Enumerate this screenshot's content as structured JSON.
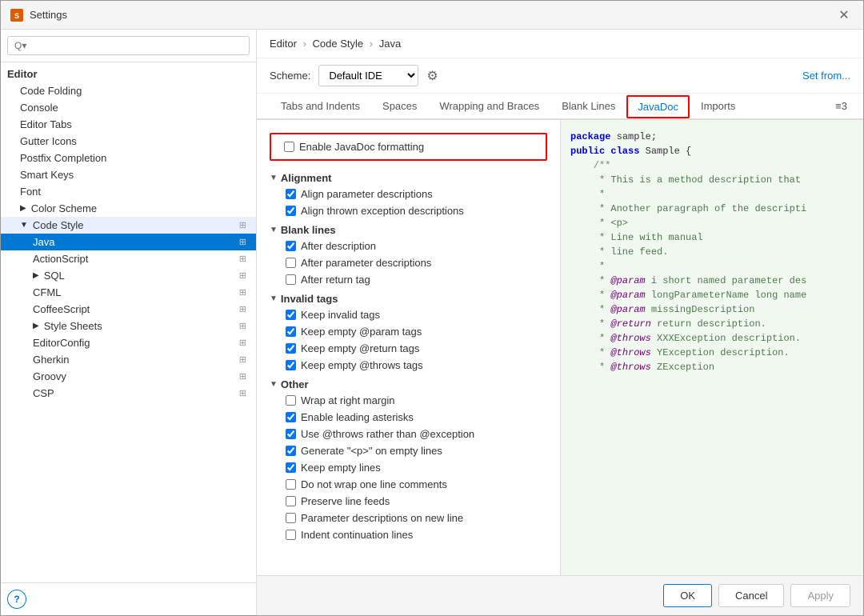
{
  "window": {
    "title": "Settings",
    "close_label": "✕"
  },
  "search": {
    "placeholder": "Q▾",
    "value": ""
  },
  "sidebar": {
    "sections": [
      {
        "id": "editor",
        "label": "Editor",
        "level": "parent",
        "expanded": true
      },
      {
        "id": "code-folding",
        "label": "Code Folding",
        "level": "level1"
      },
      {
        "id": "console",
        "label": "Console",
        "level": "level1"
      },
      {
        "id": "editor-tabs",
        "label": "Editor Tabs",
        "level": "level1"
      },
      {
        "id": "gutter-icons",
        "label": "Gutter Icons",
        "level": "level1"
      },
      {
        "id": "postfix-completion",
        "label": "Postfix Completion",
        "level": "level1"
      },
      {
        "id": "smart-keys",
        "label": "Smart Keys",
        "level": "level1"
      },
      {
        "id": "font",
        "label": "Font",
        "level": "level1"
      },
      {
        "id": "color-scheme",
        "label": "Color Scheme",
        "level": "level1",
        "expandable": true
      },
      {
        "id": "code-style",
        "label": "Code Style",
        "level": "level1",
        "expandable": true,
        "expanded": true,
        "selected_parent": true
      },
      {
        "id": "java",
        "label": "Java",
        "level": "level2",
        "selected": true
      },
      {
        "id": "actionscript",
        "label": "ActionScript",
        "level": "level2"
      },
      {
        "id": "sql",
        "label": "SQL",
        "level": "level2",
        "expandable": true
      },
      {
        "id": "cfml",
        "label": "CFML",
        "level": "level2"
      },
      {
        "id": "coffeescript",
        "label": "CoffeeScript",
        "level": "level2"
      },
      {
        "id": "style-sheets",
        "label": "Style Sheets",
        "level": "level2",
        "expandable": true
      },
      {
        "id": "editorconfig",
        "label": "EditorConfig",
        "level": "level2"
      },
      {
        "id": "gherkin",
        "label": "Gherkin",
        "level": "level2"
      },
      {
        "id": "groovy",
        "label": "Groovy",
        "level": "level2"
      },
      {
        "id": "csp",
        "label": "CSP",
        "level": "level2"
      }
    ]
  },
  "breadcrumb": {
    "items": [
      "Editor",
      "Code Style",
      "Java"
    ]
  },
  "scheme": {
    "label": "Scheme:",
    "value": "Default IDE",
    "bold_part": "Default",
    "normal_part": " IDE",
    "set_from_label": "Set from..."
  },
  "tabs": [
    {
      "id": "tabs-indents",
      "label": "Tabs and Indents"
    },
    {
      "id": "spaces",
      "label": "Spaces"
    },
    {
      "id": "wrapping",
      "label": "Wrapping and Braces"
    },
    {
      "id": "blank-lines",
      "label": "Blank Lines"
    },
    {
      "id": "javadoc",
      "label": "JavaDoc",
      "active": true,
      "highlighted": true
    },
    {
      "id": "imports",
      "label": "Imports"
    },
    {
      "id": "more",
      "label": "≡3"
    }
  ],
  "javadoc": {
    "enable_label": "Enable JavaDoc formatting",
    "enable_checked": false,
    "sections": [
      {
        "id": "alignment",
        "label": "Alignment",
        "expanded": true,
        "items": [
          {
            "id": "align-param",
            "label": "Align parameter descriptions",
            "checked": true
          },
          {
            "id": "align-throws",
            "label": "Align thrown exception descriptions",
            "checked": true
          }
        ]
      },
      {
        "id": "blank-lines",
        "label": "Blank lines",
        "expanded": true,
        "items": [
          {
            "id": "after-desc",
            "label": "After description",
            "checked": true
          },
          {
            "id": "after-param",
            "label": "After parameter descriptions",
            "checked": false
          },
          {
            "id": "after-return",
            "label": "After return tag",
            "checked": false
          }
        ]
      },
      {
        "id": "invalid-tags",
        "label": "Invalid tags",
        "expanded": true,
        "items": [
          {
            "id": "keep-invalid",
            "label": "Keep invalid tags",
            "checked": true
          },
          {
            "id": "keep-empty-param",
            "label": "Keep empty @param tags",
            "checked": true
          },
          {
            "id": "keep-empty-return",
            "label": "Keep empty @return tags",
            "checked": true
          },
          {
            "id": "keep-empty-throws",
            "label": "Keep empty @throws tags",
            "checked": true
          }
        ]
      },
      {
        "id": "other",
        "label": "Other",
        "expanded": true,
        "items": [
          {
            "id": "wrap-right",
            "label": "Wrap at right margin",
            "checked": false
          },
          {
            "id": "enable-asterisks",
            "label": "Enable leading asterisks",
            "checked": true
          },
          {
            "id": "use-throws",
            "label": "Use @throws rather than @exception",
            "checked": true
          },
          {
            "id": "generate-p",
            "label": "Generate \"<p>\" on empty lines",
            "checked": true
          },
          {
            "id": "keep-empty",
            "label": "Keep empty lines",
            "checked": true
          },
          {
            "id": "no-wrap-one-line",
            "label": "Do not wrap one line comments",
            "checked": false
          },
          {
            "id": "preserve-feeds",
            "label": "Preserve line feeds",
            "checked": false
          },
          {
            "id": "param-new-line",
            "label": "Parameter descriptions on new line",
            "checked": false
          },
          {
            "id": "indent-cont",
            "label": "Indent continuation lines",
            "checked": false
          }
        ]
      }
    ]
  },
  "preview": {
    "lines": [
      "package sample;",
      "",
      "public class Sample {",
      "    /**",
      "     * This is a method description that",
      "     *",
      "     * Another paragraph of the descripti",
      "     * <p>",
      "     * Line with manual",
      "     * line feed.",
      "     *",
      "     * @param i short named parameter des",
      "     * @param longParameterName long name",
      "     * @param missingDescription",
      "     * @return return description.",
      "     * @throws XXXException description.",
      "     * @throws YException description.",
      "     * @throws ZException"
    ]
  },
  "footer": {
    "ok_label": "OK",
    "cancel_label": "Cancel",
    "apply_label": "Apply"
  }
}
